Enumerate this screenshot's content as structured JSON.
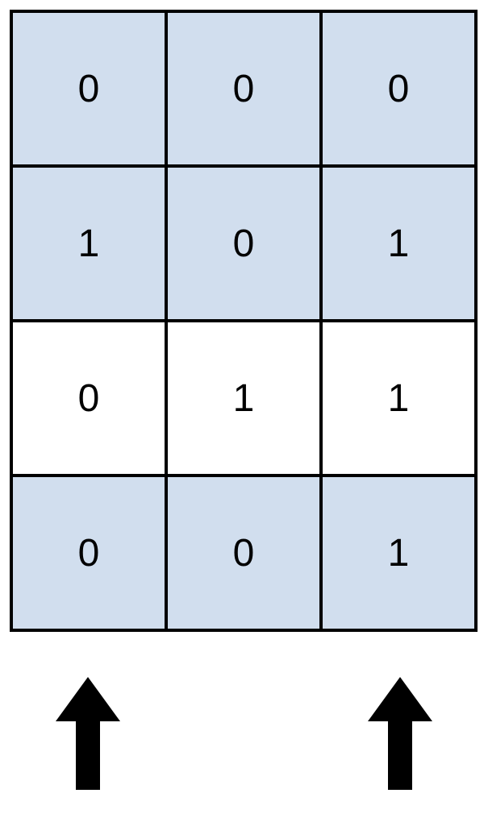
{
  "chart_data": {
    "type": "table",
    "title": "",
    "cells": [
      [
        {
          "value": "0",
          "shaded": true
        },
        {
          "value": "0",
          "shaded": true
        },
        {
          "value": "0",
          "shaded": true
        }
      ],
      [
        {
          "value": "1",
          "shaded": true
        },
        {
          "value": "0",
          "shaded": true
        },
        {
          "value": "1",
          "shaded": true
        }
      ],
      [
        {
          "value": "0",
          "shaded": false
        },
        {
          "value": "1",
          "shaded": false
        },
        {
          "value": "1",
          "shaded": false
        }
      ],
      [
        {
          "value": "0",
          "shaded": true
        },
        {
          "value": "0",
          "shaded": true
        },
        {
          "value": "1",
          "shaded": true
        }
      ]
    ],
    "arrows": {
      "column0": true,
      "column1": false,
      "column2": true
    }
  }
}
